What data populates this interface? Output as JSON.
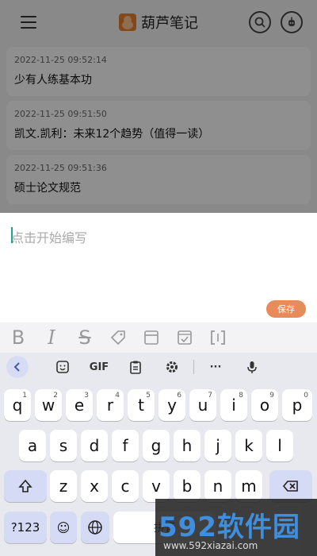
{
  "header": {
    "title": "葫芦笔记",
    "menu_icon": "hamburger-menu-icon",
    "search_icon": "search-icon",
    "profile_icon": "robot-icon"
  },
  "notes": [
    {
      "date": "2022-11-25 09:52:14",
      "title": "少有人练基本功"
    },
    {
      "date": "2022-11-25 09:51:50",
      "title": "凯文.凯利：未来12个趋势（值得一读）"
    },
    {
      "date": "2022-11-25 09:51:36",
      "title": "硕士论文规范"
    }
  ],
  "editor": {
    "placeholder": "点击开始编写",
    "save_label": "保存"
  },
  "format_toolbar": {
    "bold": "B",
    "italic": "I",
    "strike": "S",
    "icons": [
      "bold-icon",
      "italic-icon",
      "strikethrough-icon",
      "tag-icon",
      "window-icon",
      "checkbox-icon",
      "bracket-icon"
    ]
  },
  "keyboard": {
    "tools": {
      "gif_label": "GIF",
      "more_label": "···"
    },
    "row1": [
      {
        "k": "q",
        "h": "1"
      },
      {
        "k": "w",
        "h": "2"
      },
      {
        "k": "e",
        "h": "3"
      },
      {
        "k": "r",
        "h": "4"
      },
      {
        "k": "t",
        "h": "5"
      },
      {
        "k": "y",
        "h": "6"
      },
      {
        "k": "u",
        "h": "7"
      },
      {
        "k": "i",
        "h": "8"
      },
      {
        "k": "o",
        "h": "9"
      },
      {
        "k": "p",
        "h": "0"
      }
    ],
    "row2": [
      "a",
      "s",
      "d",
      "f",
      "g",
      "h",
      "j",
      "k",
      "l"
    ],
    "row3": [
      "z",
      "x",
      "c",
      "v",
      "b",
      "n",
      "m"
    ],
    "row4": {
      "numbers": "?123",
      "emoji": "☺",
      "space_hint": "拼音"
    }
  },
  "watermark": {
    "logo": "592软件园",
    "url": "www.592xiazai.com"
  },
  "colors": {
    "accent": "#e98a5a",
    "caret": "#1aa38a",
    "key_func": "#d5dbf4"
  }
}
